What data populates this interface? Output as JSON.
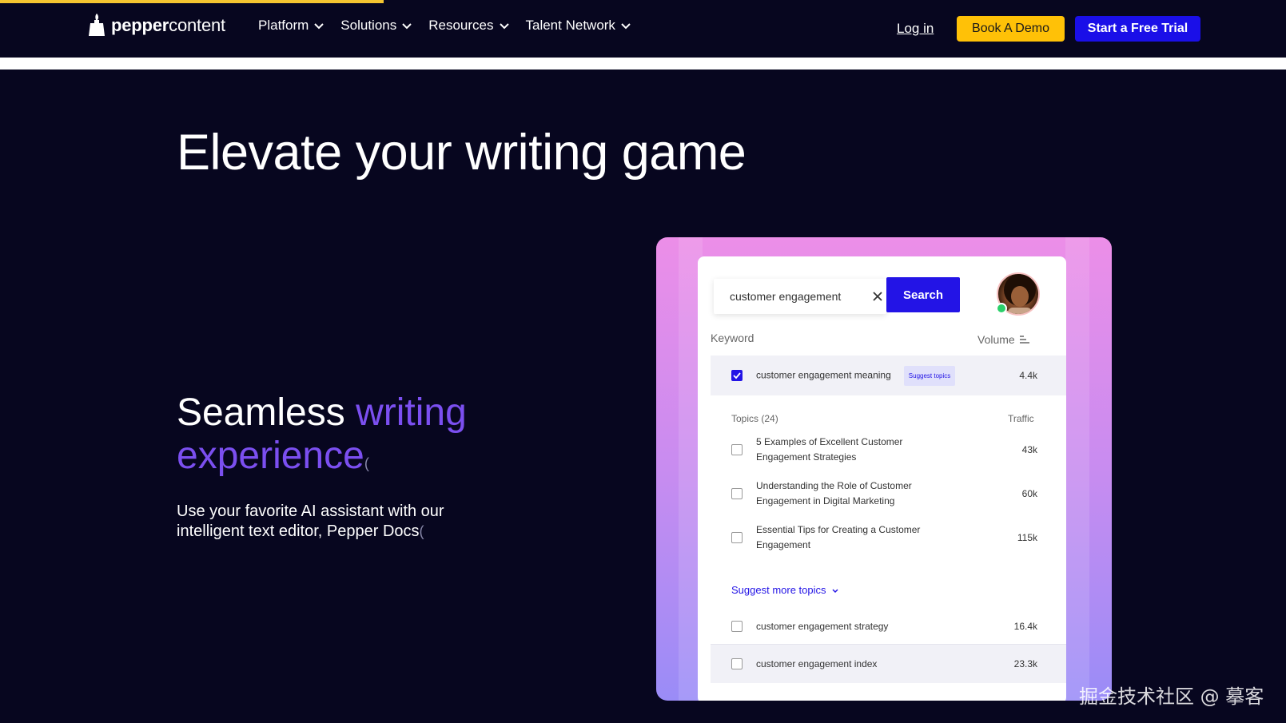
{
  "nav": {
    "logo_bold": "pepper",
    "logo_light": "content",
    "items": [
      {
        "label": "Platform"
      },
      {
        "label": "Solutions"
      },
      {
        "label": "Resources"
      },
      {
        "label": "Talent Network"
      }
    ],
    "login": "Log in",
    "demo": "Book A Demo",
    "trial": "Start a Free Trial"
  },
  "hero": {
    "title": "Elevate your writing game"
  },
  "feature": {
    "heading_plain": "Seamless ",
    "heading_accent": "writing experience",
    "description": "Use your favorite AI assistant with our intelligent text editor, Pepper Docs"
  },
  "mockup": {
    "search_value": "customer engagement",
    "search_button": "Search",
    "col_keyword": "Keyword",
    "col_volume": "Volume",
    "primary_row": {
      "label": "customer engagement meaning",
      "tag": "Suggest topics",
      "value": "4.4k",
      "checked": true
    },
    "topics_header": "Topics (24)",
    "traffic_header": "Traffic",
    "topics": [
      {
        "line1": "5 Examples of Excellent Customer",
        "line2": "Engagement Strategies",
        "value": "43k"
      },
      {
        "line1": "Understanding the Role of Customer",
        "line2": "Engagement in Digital Marketing",
        "value": "60k"
      },
      {
        "line1": "Essential Tips for Creating a Customer",
        "line2": "Engagement",
        "value": "115k"
      }
    ],
    "suggest_more": "Suggest more topics",
    "keywords": [
      {
        "label": "customer engagement strategy",
        "value": "16.4k"
      },
      {
        "label": "customer engagement index",
        "value": "23.3k"
      }
    ]
  },
  "watermark": "掘金技术社区 @ 摹客",
  "colors": {
    "background": "#07061f",
    "accent_purple": "#7b4ff0",
    "demo_yellow": "#ffc107",
    "trial_blue": "#1a0fe8",
    "search_blue": "#2314e6"
  }
}
